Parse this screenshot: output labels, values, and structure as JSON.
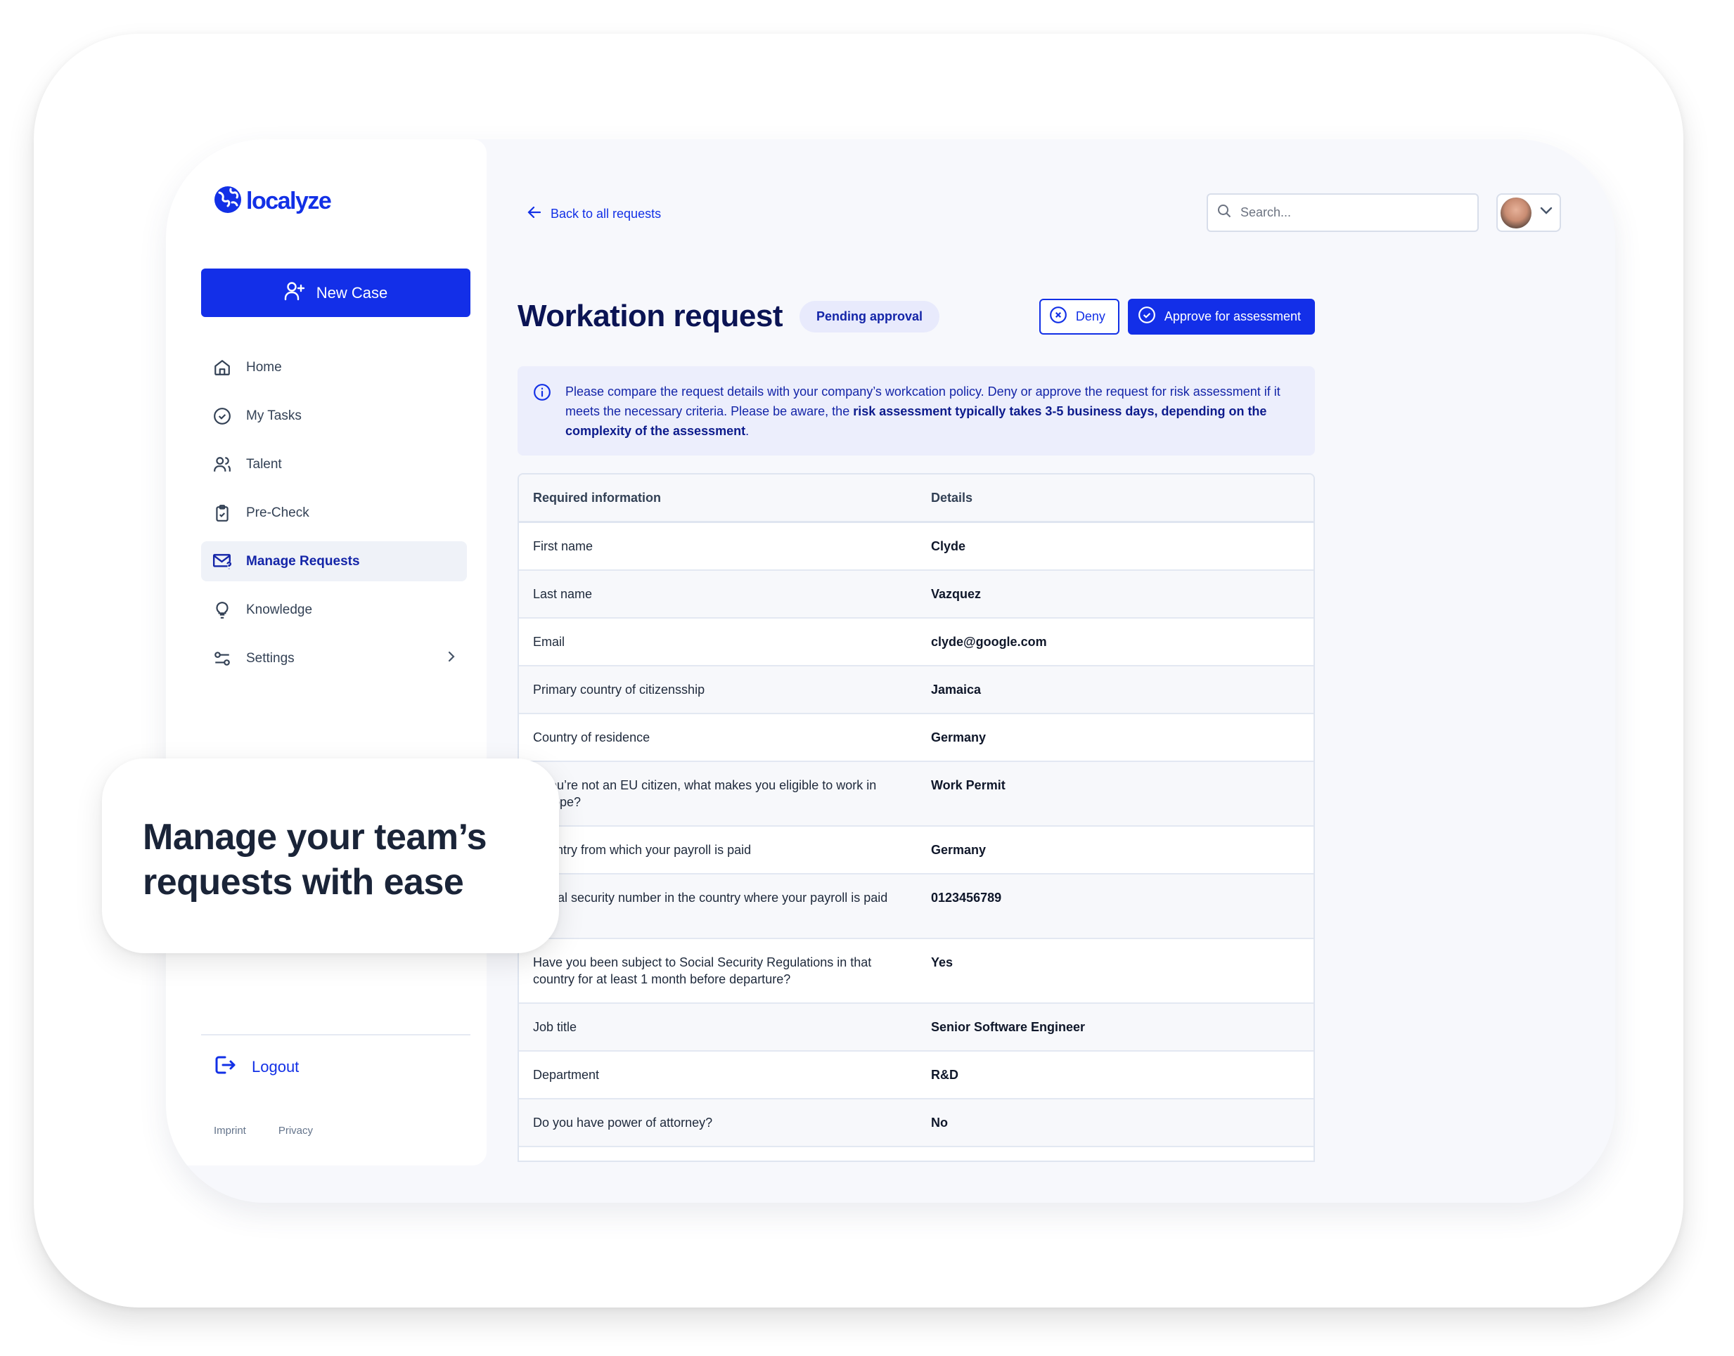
{
  "brand": {
    "name": "localyze",
    "accent": "#132fe8"
  },
  "sidebar": {
    "new_case_label": "New Case",
    "items": [
      {
        "label": "Home",
        "icon": "home-icon"
      },
      {
        "label": "My Tasks",
        "icon": "check-circle-icon"
      },
      {
        "label": "Talent",
        "icon": "users-icon"
      },
      {
        "label": "Pre-Check",
        "icon": "clipboard-check-icon"
      },
      {
        "label": "Manage Requests",
        "icon": "mail-question-icon",
        "active": true
      },
      {
        "label": "Knowledge",
        "icon": "lightbulb-icon"
      },
      {
        "label": "Settings",
        "icon": "sliders-icon"
      }
    ],
    "logout_label": "Logout",
    "footer": {
      "imprint": "Imprint",
      "privacy": "Privacy"
    }
  },
  "header": {
    "back_label": "Back to all requests",
    "search_placeholder": "Search..."
  },
  "page": {
    "title": "Workation request",
    "status_badge": "Pending approval",
    "deny_label": "Deny",
    "approve_label": "Approve for assessment"
  },
  "info": {
    "text_regular": "Please compare the request details with your company’s workcation policy. Deny or approve the request for risk assessment if it meets the necessary criteria. Please be aware, the ",
    "text_bold": "risk assessment typically takes 3-5 business days, depending on the complexity of the assessment",
    "text_end": "."
  },
  "table": {
    "headers": [
      "Required information",
      "Details"
    ],
    "rows": [
      {
        "label": "First name",
        "value": "Clyde"
      },
      {
        "label": "Last name",
        "value": "Vazquez"
      },
      {
        "label": "Email",
        "value": "clyde@google.com"
      },
      {
        "label": "Primary country of citizensship",
        "value": "Jamaica"
      },
      {
        "label": "Country of residence",
        "value": "Germany"
      },
      {
        "label": "If you’re not an EU citizen, what makes you eligible to work in Europe?",
        "value": "Work Permit"
      },
      {
        "label": "Country from which your payroll is paid",
        "value": "Germany"
      },
      {
        "label": "Social security number in the country where your payroll is paid from",
        "value": "0123456789"
      },
      {
        "label": "Have you been subject to Social Security Regulations in that country for at least 1 month before departure?",
        "value": "Yes"
      },
      {
        "label": "Job title",
        "value": "Senior Software Engineer"
      },
      {
        "label": "Department",
        "value": "R&D"
      },
      {
        "label": "Do you have power of attorney?",
        "value": "No"
      }
    ]
  },
  "overlay": {
    "headline": "Manage your team’s requests with ease"
  }
}
